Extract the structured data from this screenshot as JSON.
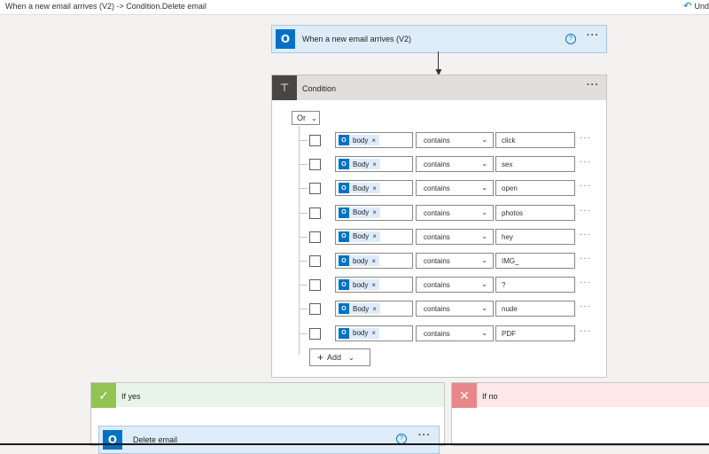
{
  "header": {
    "breadcrumb": "When a new email arrives (V2) -> Condition.Delete email",
    "undo_label": "Und"
  },
  "trigger": {
    "title": "When a new email arrives (V2)",
    "icon": "outlook-icon",
    "help": "?",
    "more": "···"
  },
  "condition": {
    "title": "Condition",
    "more": "···",
    "group_operator": "Or",
    "add_label": "Add",
    "rows": [
      {
        "field": "body",
        "operator": "contains",
        "value": "click"
      },
      {
        "field": "Body",
        "operator": "contains",
        "value": "sex"
      },
      {
        "field": "Body",
        "operator": "contains",
        "value": "open"
      },
      {
        "field": "Body",
        "operator": "contains",
        "value": "photos"
      },
      {
        "field": "Body",
        "operator": "contains",
        "value": "hey"
      },
      {
        "field": "body",
        "operator": "contains",
        "value": "IMG_"
      },
      {
        "field": "body",
        "operator": "contains",
        "value": "?"
      },
      {
        "field": "Body",
        "operator": "contains",
        "value": "nude"
      },
      {
        "field": "body",
        "operator": "contains",
        "value": "PDF"
      }
    ]
  },
  "if_yes": {
    "title": "If yes",
    "action_title": "Delete email",
    "help": "?",
    "more": "···"
  },
  "if_no": {
    "title": "If no"
  },
  "colors": {
    "accent": "#0078d4",
    "outlook": "#0072c6",
    "yes": "#92c353",
    "no": "#e8878a"
  }
}
